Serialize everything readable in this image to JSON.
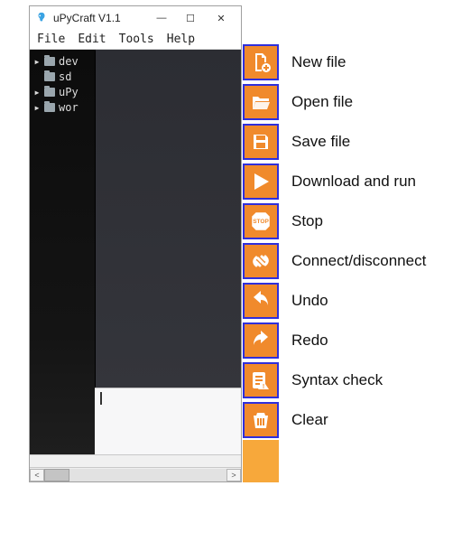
{
  "window": {
    "title": "uPyCraft V1.1",
    "controls": {
      "min": "—",
      "max": "☐",
      "close": "✕"
    }
  },
  "menu": {
    "items": [
      "File",
      "Edit",
      "Tools",
      "Help"
    ]
  },
  "tree": {
    "items": [
      {
        "label": "dev",
        "expandable": true
      },
      {
        "label": "sd",
        "expandable": false
      },
      {
        "label": "uPy",
        "expandable": true
      },
      {
        "label": "wor",
        "expandable": true
      }
    ]
  },
  "toolbar": {
    "buttons": [
      {
        "icon": "new-file-icon",
        "label": "New file"
      },
      {
        "icon": "open-file-icon",
        "label": "Open file"
      },
      {
        "icon": "save-file-icon",
        "label": "Save file"
      },
      {
        "icon": "download-run-icon",
        "label": "Download and run"
      },
      {
        "icon": "stop-icon",
        "label": "Stop"
      },
      {
        "icon": "connect-icon",
        "label": "Connect/disconnect"
      },
      {
        "icon": "undo-icon",
        "label": "Undo"
      },
      {
        "icon": "redo-icon",
        "label": "Redo"
      },
      {
        "icon": "syntax-check-icon",
        "label": "Syntax check"
      },
      {
        "icon": "clear-icon",
        "label": "Clear"
      }
    ]
  },
  "colors": {
    "toolbar_bg": "#f08a2c",
    "toolbar_border": "#2f2fdc"
  }
}
